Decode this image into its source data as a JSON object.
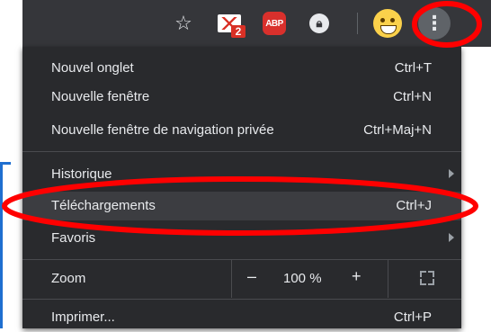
{
  "toolbar": {
    "icons": [
      "star-icon",
      "gmail-icon",
      "adblock-plus-icon",
      "lock-extension-icon",
      "profile-avatar",
      "kebab-menu-icon"
    ],
    "gmail_badge": "2",
    "abp_label": "ABP",
    "kebab_glyph": "⋮",
    "star_glyph": "☆"
  },
  "menu": {
    "items": [
      {
        "label": "Nouvel onglet",
        "shortcut": "Ctrl+T"
      },
      {
        "label": "Nouvelle fenêtre",
        "shortcut": "Ctrl+N"
      },
      {
        "label": "Nouvelle fenêtre de navigation privée",
        "shortcut": "Ctrl+Maj+N"
      },
      {
        "label": "Historique",
        "shortcut": ""
      },
      {
        "label": "Téléchargements",
        "shortcut": "Ctrl+J"
      },
      {
        "label": "Favoris",
        "shortcut": ""
      },
      {
        "label": "Imprimer...",
        "shortcut": "Ctrl+P"
      }
    ],
    "zoom": {
      "label": "Zoom",
      "minus": "–",
      "value": "100 %",
      "plus": "+"
    }
  },
  "colors": {
    "menu_bg": "#292a2d",
    "toolbar_bg": "#35363a",
    "text": "#e8eaed",
    "annotation": "#ff0000"
  }
}
